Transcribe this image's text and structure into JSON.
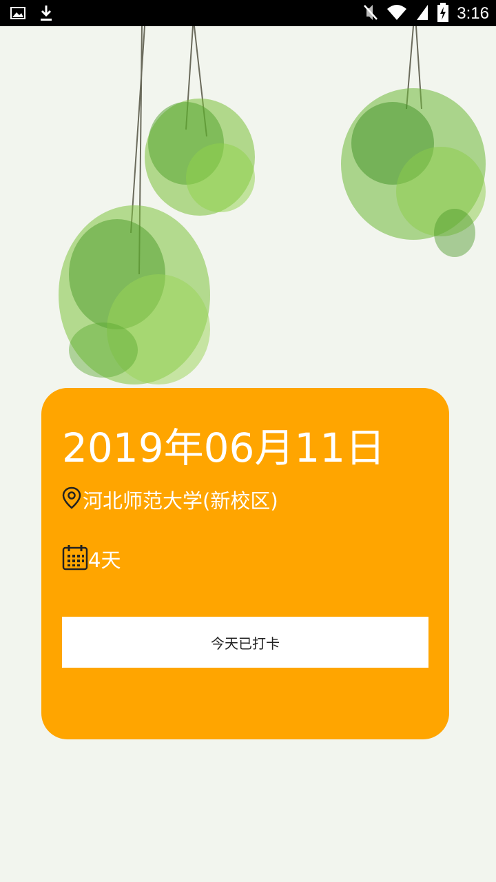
{
  "status_bar": {
    "time": "3:16",
    "left_icons": [
      "image-icon",
      "download-icon"
    ],
    "right_icons": [
      "mute-icon",
      "wifi-icon",
      "signal-icon",
      "battery-charging-icon"
    ]
  },
  "card": {
    "date": "2019年06月11日",
    "location": "河北师范大学(新校区)",
    "days": "4天",
    "button_label": "今天已打卡",
    "background_color": "#ffa500"
  }
}
